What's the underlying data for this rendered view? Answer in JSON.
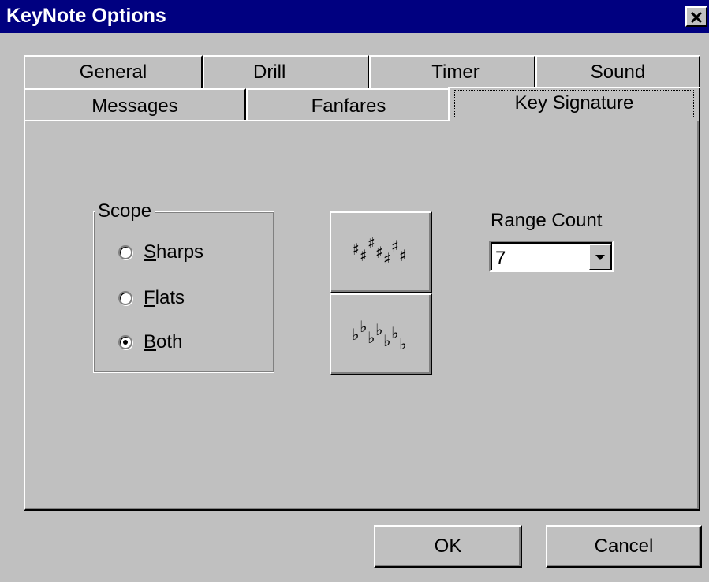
{
  "window": {
    "title": "KeyNote Options",
    "close_glyph": "✕"
  },
  "tabs_back": [
    {
      "label": "General"
    },
    {
      "label": "Drill"
    },
    {
      "label": "Timer"
    },
    {
      "label": "Sound"
    }
  ],
  "tabs_front": [
    {
      "label": "Messages"
    },
    {
      "label": "Fanfares"
    },
    {
      "label": "Key Signature",
      "active": true
    }
  ],
  "scope": {
    "label": "Scope",
    "options": [
      {
        "label": "Sharps",
        "mnemonic": "S",
        "rest": "harps",
        "selected": false
      },
      {
        "label": "Flats",
        "mnemonic": "F",
        "rest": "lats",
        "selected": false
      },
      {
        "label": "Both",
        "mnemonic": "B",
        "rest": "oth",
        "selected": true
      }
    ]
  },
  "buttons": {
    "sharps_icon": "sharps-signature-icon",
    "flats_icon": "flats-signature-icon",
    "ok": "OK",
    "cancel": "Cancel"
  },
  "range_count": {
    "label": "Range Count",
    "value": "7"
  },
  "colors": {
    "title_bar": "#000080",
    "face": "#c0c0c0"
  }
}
